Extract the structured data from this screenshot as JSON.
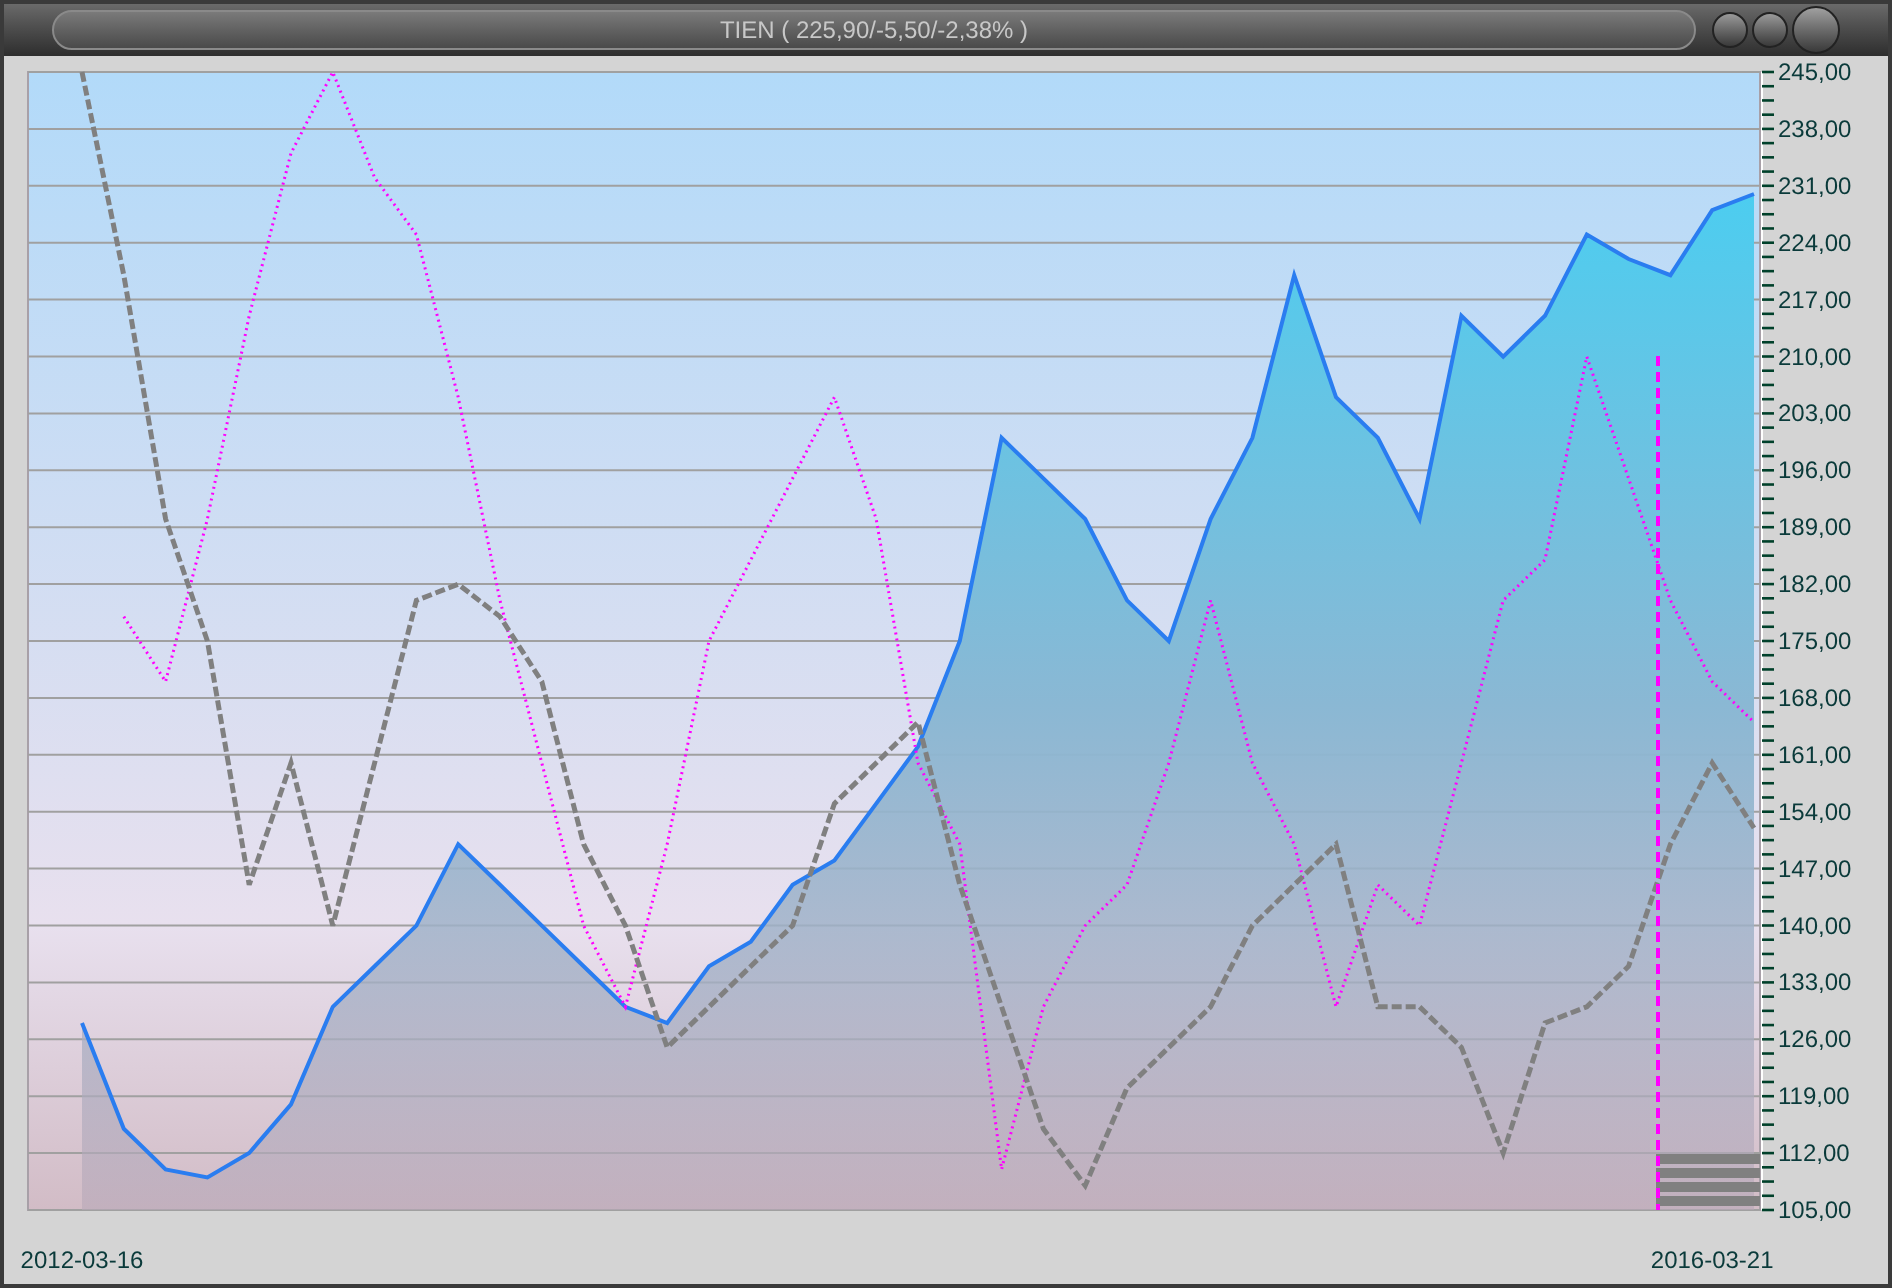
{
  "window": {
    "title": "TIEN ( 225,90/-5,50/-2,38% )"
  },
  "chart": {
    "chart_data": {
      "type": "line",
      "grid": true,
      "categories": [
        "2012-03-16",
        null,
        null,
        null,
        null,
        null,
        null,
        null,
        null,
        null,
        null,
        null,
        null,
        null,
        null,
        null,
        null,
        null,
        null,
        null,
        null,
        null,
        null,
        null,
        null,
        null,
        null,
        null,
        null,
        null,
        null,
        null,
        null,
        null,
        null,
        null,
        null,
        null,
        null,
        "2016-03-21",
        null
      ],
      "ylim": [
        105,
        245
      ],
      "yticks": [
        {
          "value": 245,
          "label": "245,00"
        },
        {
          "value": 238,
          "label": "238,00"
        },
        {
          "value": 231,
          "label": "231,00"
        },
        {
          "value": 224,
          "label": "224,00"
        },
        {
          "value": 217,
          "label": "217,00"
        },
        {
          "value": 210,
          "label": "210,00"
        },
        {
          "value": 203,
          "label": "203,00"
        },
        {
          "value": 196,
          "label": "196,00"
        },
        {
          "value": 189,
          "label": "189,00"
        },
        {
          "value": 182,
          "label": "182,00"
        },
        {
          "value": 175,
          "label": "175,00"
        },
        {
          "value": 168,
          "label": "168,00"
        },
        {
          "value": 161,
          "label": "161,00"
        },
        {
          "value": 154,
          "label": "154,00"
        },
        {
          "value": 147,
          "label": "147,00"
        },
        {
          "value": 140,
          "label": "140,00"
        },
        {
          "value": 133,
          "label": "133,00"
        },
        {
          "value": 126,
          "label": "126,00"
        },
        {
          "value": 119,
          "label": "119,00"
        },
        {
          "value": 112,
          "label": "112,00"
        },
        {
          "value": 105,
          "label": "105,00"
        }
      ],
      "series": [
        {
          "type": "area",
          "line_style": "solid",
          "color": "#2a7df0",
          "values": [
            128,
            115,
            110,
            109,
            112,
            118,
            130,
            135,
            140,
            150,
            145,
            140,
            135,
            130,
            128,
            135,
            138,
            145,
            148,
            155,
            162,
            175,
            200,
            195,
            190,
            180,
            175,
            190,
            200,
            220,
            205,
            200,
            190,
            215,
            210,
            215,
            225,
            222,
            220,
            228,
            230
          ]
        },
        {
          "type": "line",
          "line_style": "dotted",
          "color": "#ff00ff",
          "values": [
            null,
            178,
            170,
            190,
            215,
            235,
            245,
            232,
            225,
            205,
            180,
            160,
            140,
            130,
            150,
            175,
            185,
            195,
            205,
            190,
            160,
            150,
            110,
            130,
            140,
            145,
            160,
            180,
            160,
            150,
            130,
            145,
            140,
            160,
            180,
            185,
            210,
            195,
            180,
            170,
            165
          ]
        },
        {
          "type": "line",
          "line_style": "dashed",
          "color": "#808080",
          "values": [
            245,
            220,
            190,
            175,
            145,
            160,
            140,
            160,
            180,
            182,
            178,
            170,
            150,
            140,
            125,
            130,
            135,
            140,
            155,
            160,
            165,
            145,
            130,
            115,
            108,
            120,
            125,
            130,
            140,
            145,
            150,
            130,
            130,
            125,
            112,
            128,
            130,
            135,
            150,
            160,
            152
          ]
        }
      ]
    }
  }
}
